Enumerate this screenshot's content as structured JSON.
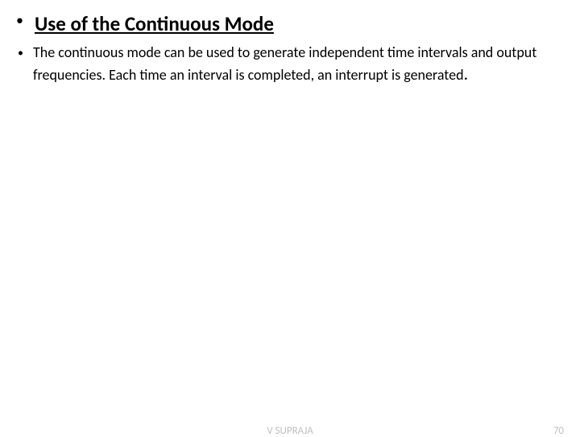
{
  "slide": {
    "title": "Use of the Continuous Mode",
    "body": "The continuous mode can be used to generate independent time intervals and output frequencies. Each time an interval is completed, an interrupt is generated",
    "body_period": "."
  },
  "footer": {
    "author": "V SUPRAJA",
    "page": "70"
  }
}
